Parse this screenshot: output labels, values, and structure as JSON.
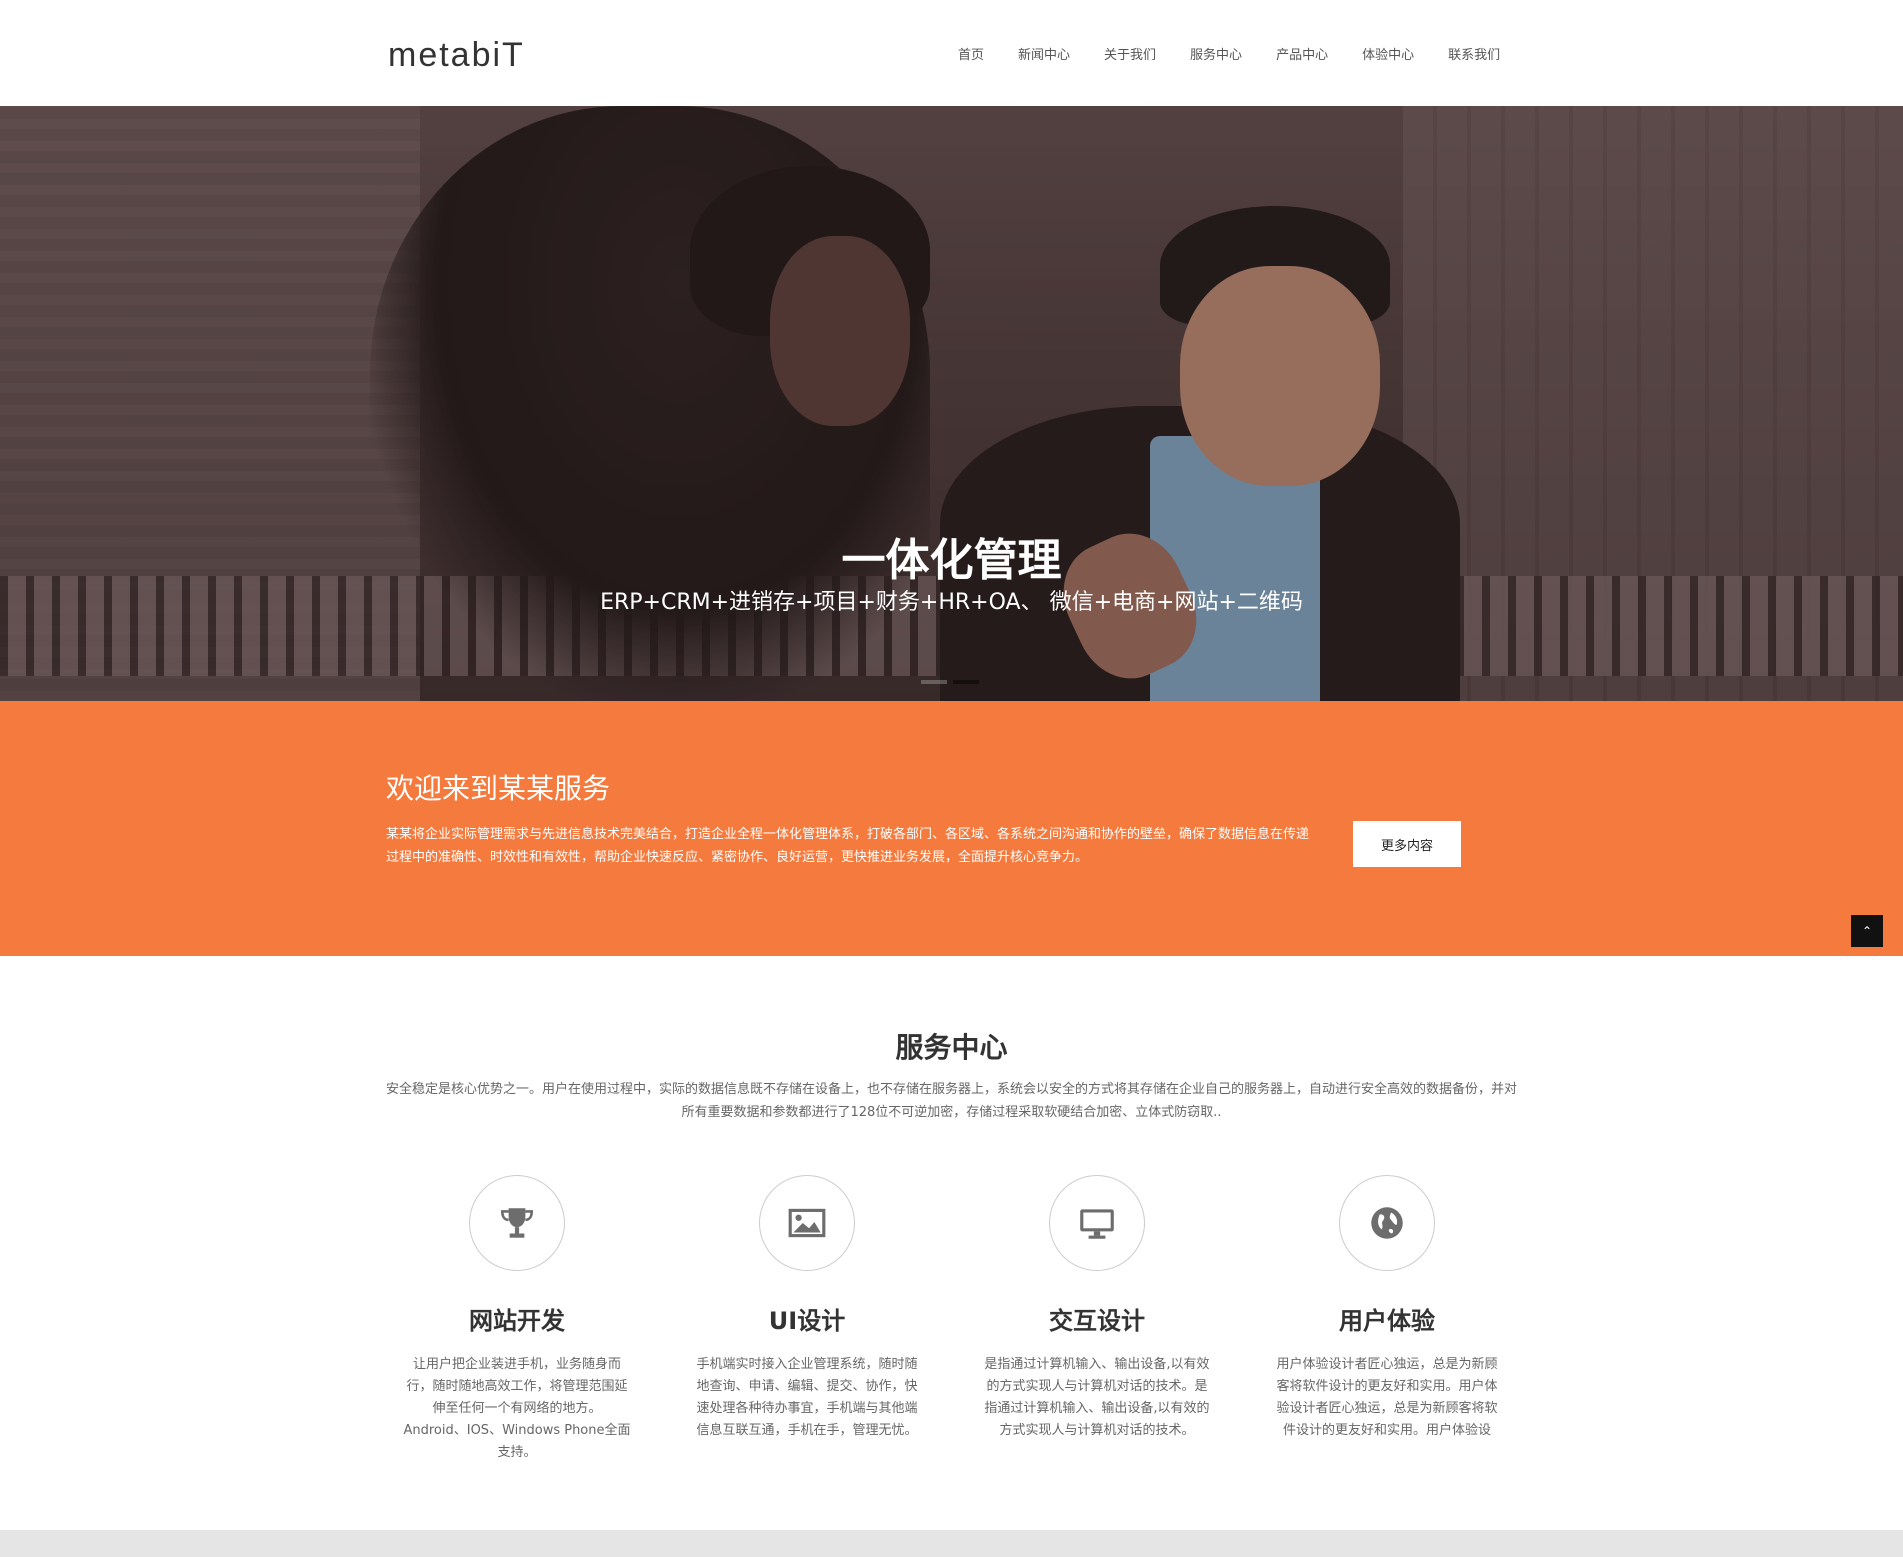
{
  "header": {
    "logo": "metabiT",
    "nav": [
      "首页",
      "新闻中心",
      "关于我们",
      "服务中心",
      "产品中心",
      "体验中心",
      "联系我们"
    ]
  },
  "hero": {
    "title": "一体化管理",
    "subtitle": "ERP+CRM+进销存+项目+财务+HR+OA、 微信+电商+网站+二维码"
  },
  "welcome": {
    "title": "欢迎来到某某服务",
    "text": "某某将企业实际管理需求与先进信息技术完美结合，打造企业全程一体化管理体系，打破各部门、各区域、各系统之间沟通和协作的壁垒，确保了数据信息在传递过程中的准确性、时效性和有效性，帮助企业快速反应、紧密协作、良好运营，更快推进业务发展，全面提升核心竞争力。",
    "more_label": "更多内容",
    "top_label": "⌃"
  },
  "services": {
    "title": "服务中心",
    "desc": "安全稳定是核心优势之一。用户在使用过程中，实际的数据信息既不存储在设备上，也不存储在服务器上，系统会以安全的方式将其存储在企业自己的服务器上，自动进行安全高效的数据备份，并对所有重要数据和参数都进行了128位不可逆加密，存储过程采取软硬结合加密、立体式防窃取..",
    "items": [
      {
        "icon": "trophy-icon",
        "name": "网站开发",
        "text": "让用户把企业装进手机，业务随身而行，随时随地高效工作，将管理范围延伸至任何一个有网络的地方。Android、IOS、Windows Phone全面支持。"
      },
      {
        "icon": "image-icon",
        "name": "UI设计",
        "text": "手机端实时接入企业管理系统，随时随地查询、申请、编辑、提交、协作，快速处理各种待办事宜，手机端与其他端信息互联互通，手机在手，管理无忧。"
      },
      {
        "icon": "monitor-icon",
        "name": "交互设计",
        "text": "是指通过计算机输入、输出设备,以有效的方式实现人与计算机对话的技术。是指通过计算机输入、输出设备,以有效的方式实现人与计算机对话的技术。"
      },
      {
        "icon": "globe-icon",
        "name": "用户体验",
        "text": "用户体验设计者匠心独运，总是为新顾客将软件设计的更友好和实用。用户体验设计者匠心独运，总是为新顾客将软件设计的更友好和实用。用户体验设"
      }
    ]
  },
  "colors": {
    "accent": "#f47a3d",
    "dark": "#333333"
  }
}
